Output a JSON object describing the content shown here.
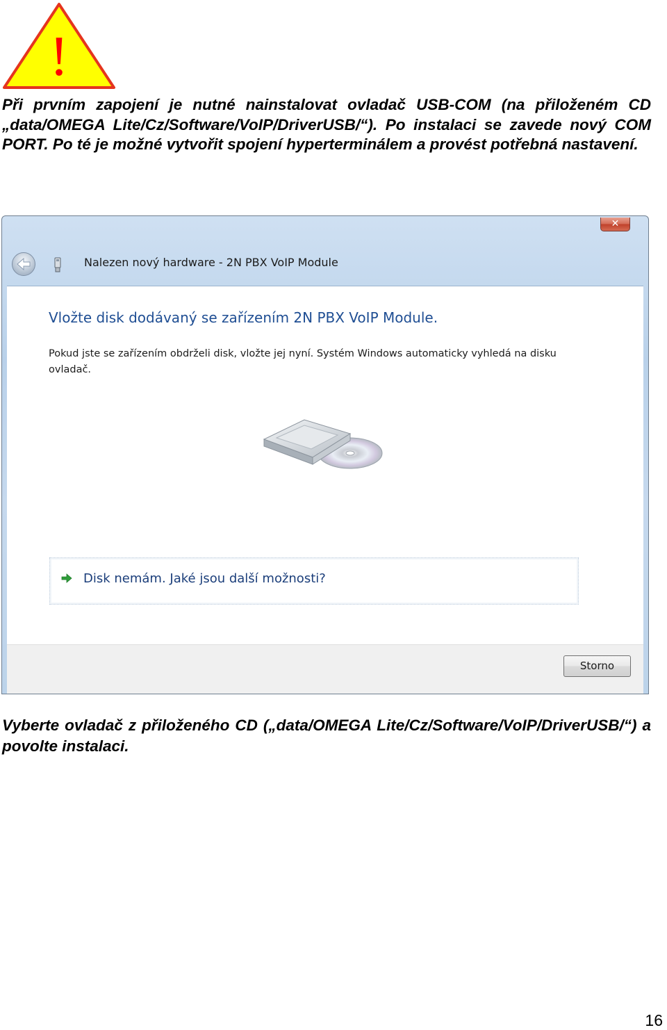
{
  "warning": {
    "glyph": "!",
    "icon": "warning-triangle-icon",
    "fill": "#ffff00",
    "border": "#e5341e",
    "glyph_color": "#ff0000"
  },
  "intro_text": "Při prvním zapojení je nutné nainstalovat ovladač USB-COM (na přiloženém CD „data/OMEGA Lite/Cz/Software/VoIP/DriverUSB/“). Po instalaci se zavede nový COM PORT. Po té je možné vytvořit spojení hyperterminálem a provést potřebná nastavení.",
  "dialog": {
    "title": "Nalezen nový hardware - 2N PBX VoIP Module",
    "close_glyph": "✕",
    "heading": "Vložte disk dodávaný se zařízením 2N PBX VoIP Module.",
    "instruction": "Pokud jste se zařízením obdrželi disk, vložte jej nyní. Systém Windows automaticky vyhledá na disku ovladač.",
    "option_label": "Disk nemám. Jaké jsou další možnosti?",
    "cancel_label": "Storno"
  },
  "outro_text": "Vyberte ovladač z přiloženého CD („data/OMEGA Lite/Cz/Software/VoIP/DriverUSB/“) a povolte instalaci.",
  "page_number": "16"
}
